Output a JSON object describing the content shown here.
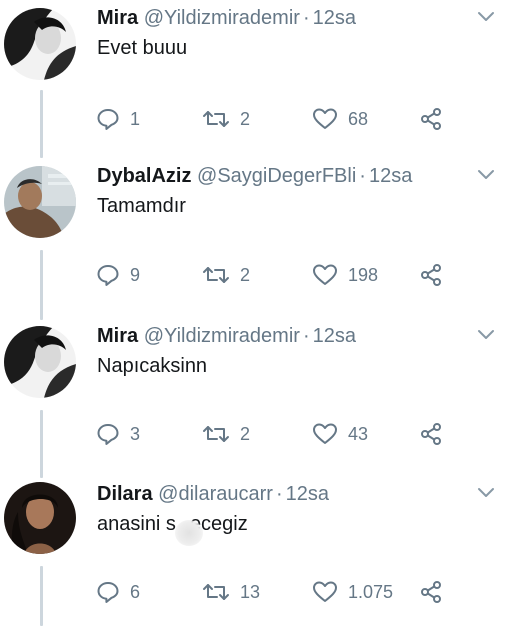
{
  "colors": {
    "muted": "#657786",
    "text": "#14171a",
    "thread": "#cdd6dd"
  },
  "tweets": [
    {
      "name": "Mira",
      "handle": "@Yildizmirademir",
      "time": "12sa",
      "text": "Evet buuu",
      "replies": "1",
      "retweets": "2",
      "likes": "68"
    },
    {
      "name": "DybalAziz",
      "handle": "@SaygiDegerFBli",
      "time": "12sa",
      "text": "Tamamdır",
      "replies": "9",
      "retweets": "2",
      "likes": "198"
    },
    {
      "name": "Mira",
      "handle": "@Yildizmirademir",
      "time": "12sa",
      "text": "Napıcaksinn",
      "replies": "3",
      "retweets": "2",
      "likes": "43"
    },
    {
      "name": "Dilara",
      "handle": "@dilaraucarr",
      "time": "12sa",
      "text_before": "anasini s",
      "text_after": "ecegiz",
      "replies": "6",
      "retweets": "13",
      "likes": "1.075"
    }
  ],
  "icons": {
    "reply": "reply-icon",
    "retweet": "retweet-icon",
    "like": "heart-icon",
    "share": "share-icon",
    "more": "chevron-down-icon"
  },
  "separator": "·"
}
